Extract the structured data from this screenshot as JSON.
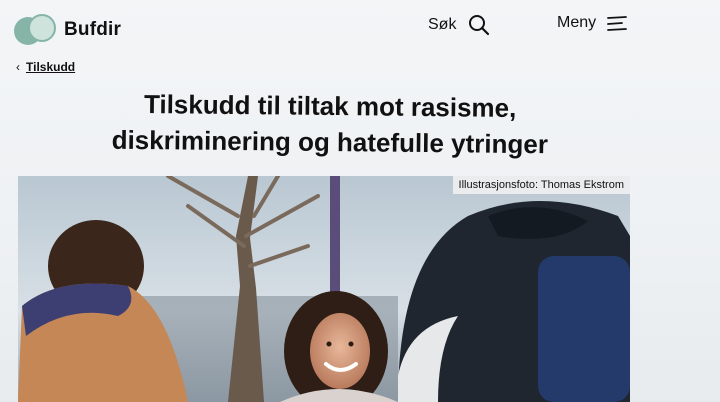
{
  "header": {
    "brand": "Bufdir",
    "search_label": "Søk",
    "menu_label": "Meny"
  },
  "breadcrumb": {
    "chevron": "‹",
    "link": "Tilskudd"
  },
  "article": {
    "title_line1": "Tilskudd til tiltak mot rasisme,",
    "title_line2": "diskriminering og hatefulle ytringer",
    "image_credit": "Illustrasjonsfoto: Thomas Ekstrom"
  },
  "icons": {
    "search": "search-icon",
    "menu": "menu-icon",
    "logo": "bufdir-logo-icon"
  },
  "colors": {
    "brand_green": "#86b5a8",
    "text": "#111111"
  }
}
